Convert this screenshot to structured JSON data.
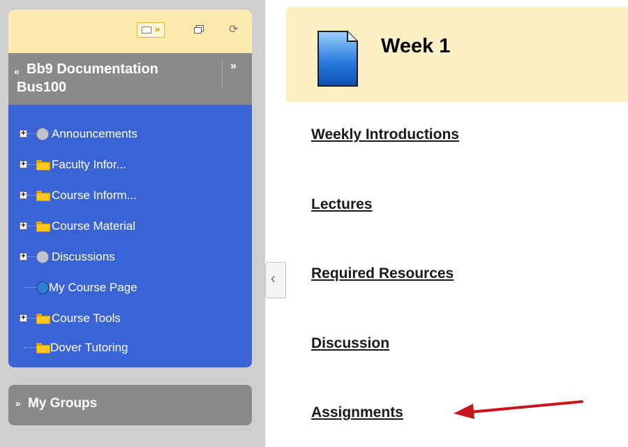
{
  "course_menu": {
    "title_line1": "Bb9 Documentation",
    "title_line2": "Bus100",
    "toolbar_icons": [
      "folder-view-icon",
      "window-icon",
      "refresh-icon"
    ],
    "items": [
      {
        "label": "Announcements",
        "icon": "announcement-icon",
        "expandable": true
      },
      {
        "label": "Faculty Infor...",
        "icon": "folder-icon",
        "expandable": true
      },
      {
        "label": "Course Inform...",
        "icon": "folder-icon",
        "expandable": true
      },
      {
        "label": "Course Material",
        "icon": "folder-icon",
        "expandable": true
      },
      {
        "label": "Discussions",
        "icon": "discussion-icon",
        "expandable": true
      },
      {
        "label": "My Course Page",
        "icon": "globe-icon",
        "expandable": false
      },
      {
        "label": "Course Tools",
        "icon": "folder-icon",
        "expandable": true
      },
      {
        "label": "Dover Tutoring",
        "icon": "folder-icon",
        "expandable": false
      }
    ]
  },
  "groups": {
    "title": "My Groups"
  },
  "content": {
    "title": "Week 1",
    "links": [
      "Weekly Introductions",
      "Lectures",
      "Required Resources",
      "Discussion",
      "Assignments"
    ]
  },
  "colors": {
    "menu_background": "#3a63d6",
    "header_background": "#fdf0c4",
    "toolbar_background": "#fbe9ad",
    "annotation_arrow": "#c8161d"
  }
}
